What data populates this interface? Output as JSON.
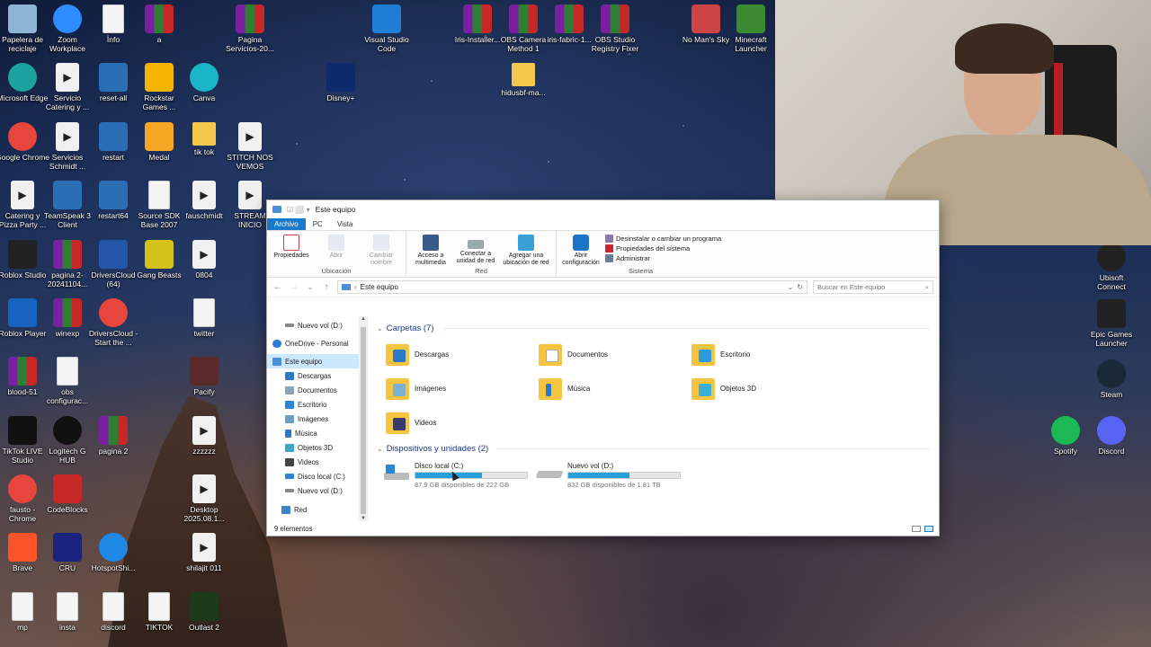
{
  "desktop": {
    "icons": [
      {
        "label": "Papelera de reciclaje",
        "icon": "recycle-bin-icon"
      },
      {
        "label": "Zoom Workplace",
        "icon": "zoom-icon"
      },
      {
        "label": "Info",
        "icon": "text-file-icon"
      },
      {
        "label": "a",
        "icon": "winrar-icon"
      },
      {
        "label": "Pagina Servicios-20...",
        "icon": "winrar-icon"
      },
      {
        "label": "Visual Studio Code",
        "icon": "vscode-icon"
      },
      {
        "label": "Iris-Installer...",
        "icon": "winrar-icon"
      },
      {
        "label": "OBS Camera Method 1",
        "icon": "winrar-icon"
      },
      {
        "label": "iris-fabric-1...",
        "icon": "winrar-icon"
      },
      {
        "label": "OBS Studio Registry Fixer",
        "icon": "winrar-icon"
      },
      {
        "label": "No Man's Sky",
        "icon": "game-icon"
      },
      {
        "label": "Minecraft Launcher",
        "icon": "minecraft-icon"
      },
      {
        "label": "Microsoft Edge",
        "icon": "edge-icon"
      },
      {
        "label": "Servicio Catering y ...",
        "icon": "video-file-icon"
      },
      {
        "label": "reset-all",
        "icon": "batch-file-icon"
      },
      {
        "label": "Rockstar Games ...",
        "icon": "rockstar-icon"
      },
      {
        "label": "Canva",
        "icon": "canva-icon"
      },
      {
        "label": "Disney+",
        "icon": "disney-plus-icon"
      },
      {
        "label": "hidusbf-ma...",
        "icon": "folder-icon"
      },
      {
        "label": "Google Chrome",
        "icon": "chrome-icon"
      },
      {
        "label": "Servicios Schmidt ...",
        "icon": "video-file-icon"
      },
      {
        "label": "restart",
        "icon": "batch-file-icon"
      },
      {
        "label": "Medal",
        "icon": "medal-icon"
      },
      {
        "label": "tik tok",
        "icon": "folder-icon"
      },
      {
        "label": "STITCH NOS VEMOS",
        "icon": "video-file-icon"
      },
      {
        "label": "Catering y Pizza Party ...",
        "icon": "video-file-icon"
      },
      {
        "label": "TeamSpeak 3 Client",
        "icon": "teamspeak-icon"
      },
      {
        "label": "restart64",
        "icon": "batch-file-icon"
      },
      {
        "label": "Source SDK Base 2007",
        "icon": "document-icon"
      },
      {
        "label": "fauschmidt",
        "icon": "video-file-icon"
      },
      {
        "label": "STREAM INICIO",
        "icon": "video-file-icon"
      },
      {
        "label": "Roblox Studio",
        "icon": "roblox-studio-icon"
      },
      {
        "label": "pagina 2-20241104...",
        "icon": "winrar-icon"
      },
      {
        "label": "DriversCloud (64)",
        "icon": "driverscloud-icon"
      },
      {
        "label": "Gang Beasts",
        "icon": "gang-beasts-icon"
      },
      {
        "label": "0804",
        "icon": "video-file-icon"
      },
      {
        "label": "Roblox Player",
        "icon": "roblox-icon"
      },
      {
        "label": "winexp",
        "icon": "winrar-icon"
      },
      {
        "label": "DriversCloud - Start the ...",
        "icon": "chrome-shortcut-icon"
      },
      {
        "label": "twitter",
        "icon": "image-file-icon"
      },
      {
        "label": "blood-51",
        "icon": "winrar-icon"
      },
      {
        "label": "obs configurac...",
        "icon": "json-file-icon"
      },
      {
        "label": "Pacify",
        "icon": "pacify-icon"
      },
      {
        "label": "TikTok LIVE Studio",
        "icon": "tiktok-icon"
      },
      {
        "label": "Logitech G HUB",
        "icon": "logitech-icon"
      },
      {
        "label": "pagina 2",
        "icon": "winrar-icon"
      },
      {
        "label": "zzzzzz",
        "icon": "video-file-icon"
      },
      {
        "label": "fausto - Chrome",
        "icon": "chrome-icon"
      },
      {
        "label": "CodeBlocks",
        "icon": "codeblocks-icon"
      },
      {
        "label": "Desktop 2025.08.1...",
        "icon": "video-file-icon"
      },
      {
        "label": "Brave",
        "icon": "brave-icon"
      },
      {
        "label": "CRU",
        "icon": "monitor-icon"
      },
      {
        "label": "HotspotShi...",
        "icon": "hotspot-shield-icon"
      },
      {
        "label": "shilajit 011",
        "icon": "video-file-icon"
      },
      {
        "label": "mp",
        "icon": "image-file-icon"
      },
      {
        "label": "insta",
        "icon": "image-file-icon"
      },
      {
        "label": "discord",
        "icon": "image-file-icon"
      },
      {
        "label": "TIKTOK",
        "icon": "image-file-icon"
      },
      {
        "label": "Outlast 2",
        "icon": "outlast-icon"
      },
      {
        "label": "Ubisoft Connect",
        "icon": "ubisoft-icon"
      },
      {
        "label": "Epic Games Launcher",
        "icon": "epic-games-icon"
      },
      {
        "label": "Steam",
        "icon": "steam-icon"
      },
      {
        "label": "Spotify",
        "icon": "spotify-icon"
      },
      {
        "label": "Discord",
        "icon": "discord-icon"
      }
    ]
  },
  "explorer": {
    "title": "Este equipo",
    "tabs": [
      "Archivo",
      "PC",
      "Vista"
    ],
    "ribbon": {
      "groups": [
        {
          "name": "Ubicación",
          "buttons": [
            "Propiedades",
            "Abrir",
            "Cambiar nombre"
          ]
        },
        {
          "name": "Red",
          "buttons": [
            "Acceso a multimedia",
            "Conectar a unidad de red",
            "Agregar una ubicación de red"
          ]
        },
        {
          "name": "Sistema",
          "buttons": [
            "Abrir configuración"
          ],
          "small": [
            "Desinstalar o cambiar un programa",
            "Propiedades del sistema",
            "Administrar"
          ]
        }
      ]
    },
    "address": {
      "path": "Este equipo",
      "search_placeholder": "Buscar en Este equipo"
    },
    "nav": [
      "Nuevo vol (D:)",
      "OneDrive - Personal",
      "Este equipo",
      "Descargas",
      "Documentos",
      "Escritorio",
      "Imágenes",
      "Música",
      "Objetos 3D",
      "Videos",
      "Disco local (C:)",
      "Nuevo vol (D:)",
      "Red"
    ],
    "folders_header": "Carpetas (7)",
    "folders": [
      "Descargas",
      "Documentos",
      "Escritorio",
      "Imágenes",
      "Música",
      "Objetos 3D",
      "Videos"
    ],
    "devices_header": "Dispositivos y unidades (2)",
    "drives": [
      {
        "name": "Disco local (C:)",
        "free": "87,9 GB disponibles de 222 GB",
        "used_fraction": 0.6
      },
      {
        "name": "Nuevo vol (D:)",
        "free": "832 GB disponibles de 1,81 TB",
        "used_fraction": 0.55
      }
    ],
    "status": "9 elementos"
  },
  "colors": {
    "accent": "#1979ca",
    "drive_bar": "#26a0da",
    "selection": "#cce8ff"
  }
}
